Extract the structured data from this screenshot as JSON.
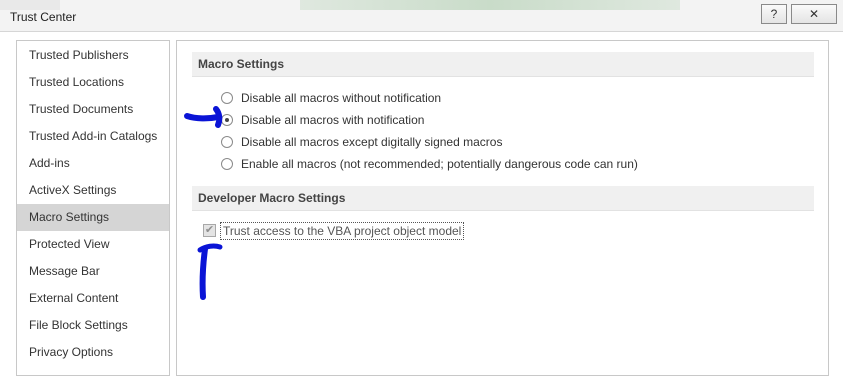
{
  "window": {
    "title": "Trust Center",
    "help_glyph": "?",
    "close_glyph": "✕"
  },
  "sidebar": {
    "items": [
      {
        "label": "Trusted Publishers"
      },
      {
        "label": "Trusted Locations"
      },
      {
        "label": "Trusted Documents"
      },
      {
        "label": "Trusted Add-in Catalogs"
      },
      {
        "label": "Add-ins"
      },
      {
        "label": "ActiveX Settings"
      },
      {
        "label": "Macro Settings",
        "selected": true
      },
      {
        "label": "Protected View"
      },
      {
        "label": "Message Bar"
      },
      {
        "label": "External Content"
      },
      {
        "label": "File Block Settings"
      },
      {
        "label": "Privacy Options"
      }
    ]
  },
  "macro_settings": {
    "header": "Macro Settings",
    "options": [
      {
        "label": "Disable all macros without notification",
        "checked": false
      },
      {
        "label": "Disable all macros with notification",
        "checked": true
      },
      {
        "label": "Disable all macros except digitally signed macros",
        "checked": false
      },
      {
        "label": "Enable all macros (not recommended; potentially dangerous code can run)",
        "checked": false
      }
    ]
  },
  "developer_macro_settings": {
    "header": "Developer Macro Settings",
    "trust_vba_label": "Trust access to the VBA project object model",
    "trust_vba_checked": true,
    "trust_vba_enabled": false,
    "check_glyph": "✔"
  },
  "annotations": {
    "color": "#0a14d6"
  },
  "colors": {
    "selected_nav_bg": "#d5d5d5",
    "section_header_bg": "#f0f0f0"
  }
}
